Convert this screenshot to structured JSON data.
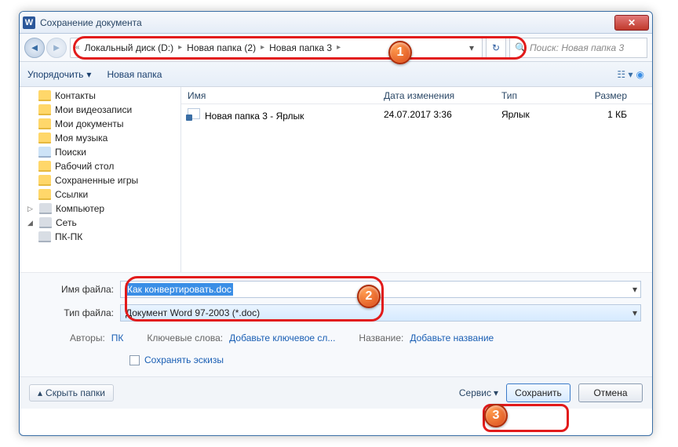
{
  "window": {
    "title": "Сохранение документа"
  },
  "nav": {
    "crumbs": [
      "Локальный диск (D:)",
      "Новая папка (2)",
      "Новая папка 3"
    ],
    "search_placeholder": "Поиск: Новая папка 3"
  },
  "toolbar": {
    "organize": "Упорядочить",
    "new_folder": "Новая папка"
  },
  "sidebar": {
    "items": [
      {
        "label": "Контакты"
      },
      {
        "label": "Мои видеозаписи"
      },
      {
        "label": "Мои документы"
      },
      {
        "label": "Моя музыка"
      },
      {
        "label": "Поиски"
      },
      {
        "label": "Рабочий стол"
      },
      {
        "label": "Сохраненные игры"
      },
      {
        "label": "Ссылки"
      }
    ],
    "computer": "Компьютер",
    "network": "Сеть",
    "network_child": "ПК-ПК"
  },
  "columns": {
    "name": "Имя",
    "date": "Дата изменения",
    "type": "Тип",
    "size": "Размер"
  },
  "files": [
    {
      "name": "Новая папка 3 - Ярлык",
      "date": "24.07.2017 3:36",
      "type": "Ярлык",
      "size": "1 КБ"
    }
  ],
  "fields": {
    "filename_label": "Имя файла:",
    "filename_value": "Как конвертировать.doc",
    "filetype_label": "Тип файла:",
    "filetype_value": "Документ Word 97-2003 (*.doc)"
  },
  "meta": {
    "authors_label": "Авторы:",
    "authors_value": "ПК",
    "keywords_label": "Ключевые слова:",
    "keywords_value": "Добавьте ключевое сл...",
    "title_label": "Название:",
    "title_value": "Добавьте название",
    "thumbs": "Сохранять эскизы"
  },
  "footer": {
    "hide": "Скрыть папки",
    "service": "Сервис",
    "save": "Сохранить",
    "cancel": "Отмена"
  },
  "badges": {
    "b1": "1",
    "b2": "2",
    "b3": "3"
  }
}
